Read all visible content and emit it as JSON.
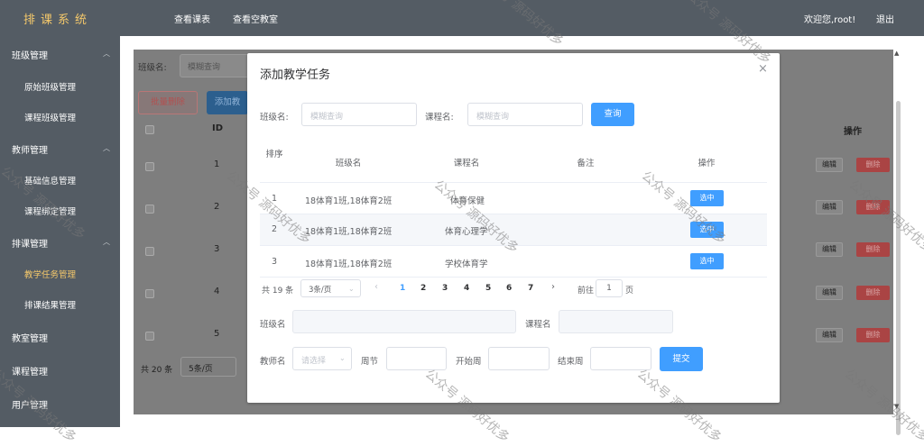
{
  "header": {
    "brand": "排课系统",
    "nav": [
      "查看课表",
      "查看空教室"
    ],
    "welcome": "欢迎您,root!",
    "logout": "退出"
  },
  "sidebar": {
    "groups": [
      {
        "label": "班级管理",
        "items": [
          "原始班级管理",
          "课程班级管理"
        ]
      },
      {
        "label": "教师管理",
        "items": [
          "基础信息管理",
          "课程绑定管理"
        ]
      },
      {
        "label": "排课管理",
        "items": [
          "教学任务管理",
          "排课结果管理"
        ]
      },
      {
        "label": "教室管理",
        "items": []
      },
      {
        "label": "课程管理",
        "items": []
      },
      {
        "label": "用户管理",
        "items": []
      }
    ],
    "active_item": "教学任务管理"
  },
  "background": {
    "class_label": "班级名:",
    "class_placeholder": "模糊查询",
    "batch_delete": "批量删除",
    "add_button": "添加教",
    "col_id": "ID",
    "col_op": "操作",
    "rows": [
      "1",
      "2",
      "3",
      "4",
      "5"
    ],
    "edit": "编辑",
    "delete": "删除",
    "total": "共 20 条",
    "page_size": "5条/页"
  },
  "dialog": {
    "title": "添加教学任务",
    "search": {
      "class_label": "班级名:",
      "class_placeholder": "模糊查询",
      "course_label": "课程名:",
      "course_placeholder": "模糊查询",
      "query_button": "查询"
    },
    "table": {
      "headers": [
        "排序",
        "班级名",
        "课程名",
        "备注",
        "操作"
      ],
      "rows": [
        {
          "index": "1",
          "class": "18体育1班,18体育2班",
          "course": "体育保健",
          "note": "",
          "action": "选中"
        },
        {
          "index": "2",
          "class": "18体育1班,18体育2班",
          "course": "体育心理学",
          "note": "",
          "action": "选中"
        },
        {
          "index": "3",
          "class": "18体育1班,18体育2班",
          "course": "学校体育学",
          "note": "",
          "action": "选中"
        }
      ]
    },
    "pagination": {
      "total": "共 19 条",
      "page_size": "3条/页",
      "pages": [
        "1",
        "2",
        "3",
        "4",
        "5",
        "6",
        "7"
      ],
      "current_page": "1",
      "goto_label": "前往",
      "goto_value": "1",
      "page_suffix": "页"
    },
    "form": {
      "class_label": "班级名",
      "course_label": "课程名",
      "teacher_label": "教师名",
      "teacher_placeholder": "请选择",
      "weekly_label": "周节",
      "start_label": "开始周",
      "end_label": "结束周",
      "submit": "提交"
    }
  },
  "watermark": "公众号 源码好优多",
  "colors": {
    "header_bg": "#545c64",
    "brand": "#f4c86b",
    "primary": "#409eff",
    "danger": "#f56c6c"
  }
}
